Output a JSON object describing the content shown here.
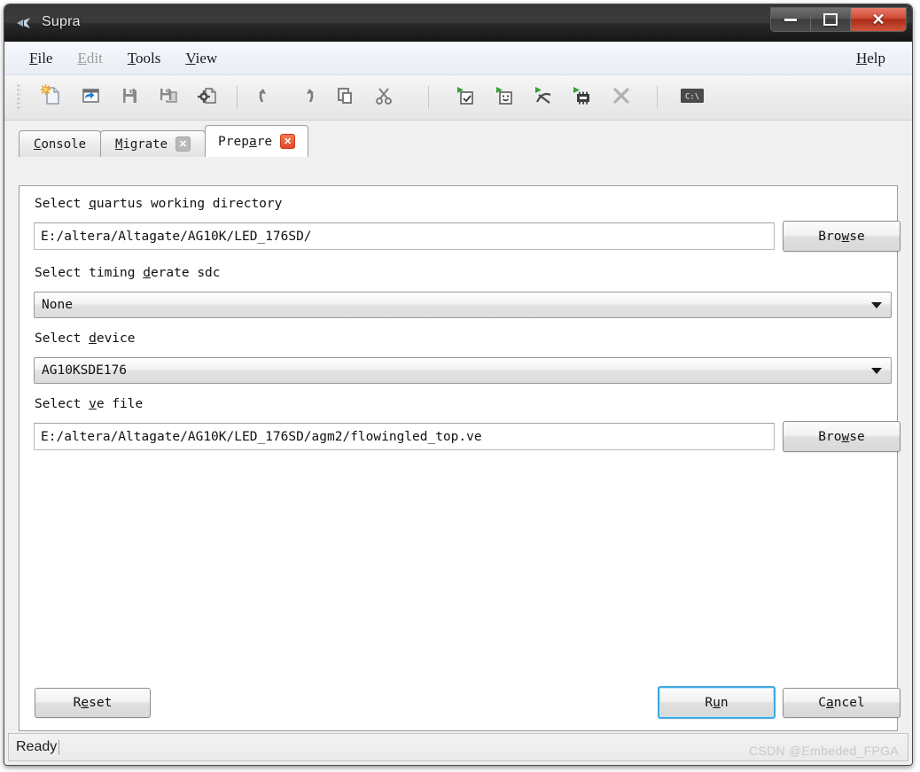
{
  "window": {
    "title": "Supra",
    "icon": "app-logo-icon",
    "controls": {
      "minimize": "minimize-icon",
      "maximize": "maximize-icon",
      "close": "close-icon"
    }
  },
  "menubar": {
    "items": [
      {
        "label": "File",
        "accel": "F",
        "disabled": false
      },
      {
        "label": "Edit",
        "accel": "E",
        "disabled": true
      },
      {
        "label": "Tools",
        "accel": "T",
        "disabled": false
      },
      {
        "label": "View",
        "accel": "V",
        "disabled": false
      }
    ],
    "help": {
      "label": "Help",
      "accel": "H"
    }
  },
  "toolbar": {
    "buttons": [
      {
        "name": "new-file-icon",
        "title": "New"
      },
      {
        "name": "open-file-icon",
        "title": "Open"
      },
      {
        "name": "save-icon",
        "title": "Save"
      },
      {
        "name": "save-as-icon",
        "title": "Save As"
      },
      {
        "name": "settings-file-icon",
        "title": "Settings"
      },
      {
        "name": "undo-icon",
        "title": "Undo"
      },
      {
        "name": "redo-icon",
        "title": "Redo"
      },
      {
        "name": "copy-icon",
        "title": "Copy"
      },
      {
        "name": "cut-icon",
        "title": "Cut"
      },
      {
        "name": "run-check-icon",
        "title": "Run Check"
      },
      {
        "name": "run-migrate-icon",
        "title": "Run Migrate"
      },
      {
        "name": "run-analyze-icon",
        "title": "Run Analyze"
      },
      {
        "name": "run-chip-icon",
        "title": "Run Device"
      },
      {
        "name": "stop-icon",
        "title": "Stop"
      },
      {
        "name": "console-icon",
        "title": "Console"
      }
    ]
  },
  "tabs": [
    {
      "label": "Console",
      "accel": "C",
      "closable": false,
      "active": false
    },
    {
      "label": "Migrate",
      "accel": "M",
      "closable": true,
      "active": false
    },
    {
      "label": "Prepare",
      "accel": "a",
      "closable": true,
      "active": true
    }
  ],
  "tab_close_glyph": "✕",
  "form": {
    "quartus_dir": {
      "label_pre": "Select ",
      "label_accel": "q",
      "label_post": "uartus working directory",
      "value": "E:/altera/Altagate/AG10K/LED_176SD/",
      "browse_pre": "Bro",
      "browse_accel": "w",
      "browse_post": "se"
    },
    "timing_derate": {
      "label_pre": "Select timing ",
      "label_accel": "d",
      "label_post": "erate sdc",
      "value": "None",
      "options": [
        "None"
      ]
    },
    "device": {
      "label_pre": "Select ",
      "label_accel": "d",
      "label_post": "evice",
      "value": "AG10KSDE176",
      "options": [
        "AG10KSDE176"
      ]
    },
    "ve_file": {
      "label_pre": "Select ",
      "label_accel": "v",
      "label_post": "e file",
      "value": "E:/altera/Altagate/AG10K/LED_176SD/agm2/flowingled_top.ve",
      "browse_pre": "Bro",
      "browse_accel": "w",
      "browse_post": "se"
    }
  },
  "actions": {
    "reset": {
      "pre": "R",
      "accel": "e",
      "post": "set"
    },
    "run": {
      "pre": "R",
      "accel": "u",
      "post": "n"
    },
    "cancel": {
      "pre": "C",
      "accel": "a",
      "post": "ncel"
    }
  },
  "statusbar": {
    "text": "Ready",
    "watermark": "CSDN @Embeded_FPGA"
  },
  "colors": {
    "accent_default_button": "#3fa9e0",
    "close_tab_active": "#e0492a",
    "window_close": "#ab2d19",
    "run_arrow_green": "#35a135",
    "new_star_orange": "#f5a623"
  }
}
